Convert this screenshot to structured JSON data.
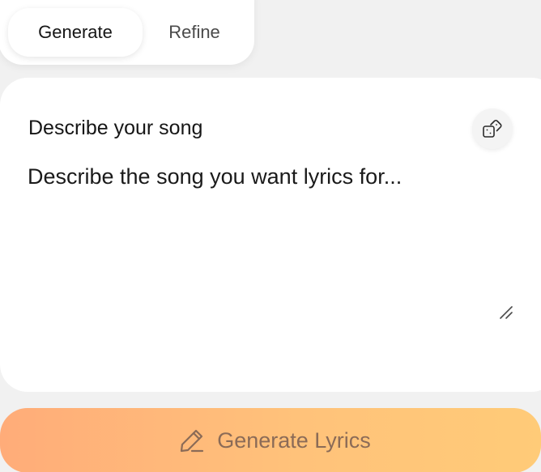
{
  "tabs": [
    {
      "label": "Generate",
      "active": true
    },
    {
      "label": "Refine",
      "active": false
    }
  ],
  "card": {
    "title": "Describe your song",
    "input_placeholder": "Describe the song you want lyrics for...",
    "input_value": "",
    "random_button_icon": "dice-icon",
    "resize_icon": "resize-handle-icon"
  },
  "action": {
    "label": "Generate Lyrics",
    "icon": "pencil-icon"
  },
  "colors": {
    "background": "#f1f1f1",
    "card": "#ffffff",
    "gradient_start": "#ffac79",
    "gradient_end": "#ffcb78",
    "button_text": "#8b6b57"
  }
}
